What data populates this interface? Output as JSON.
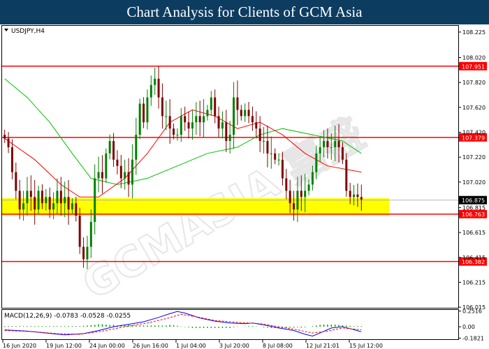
{
  "header": {
    "title": "Chart Analysis for Clients of GCM Asia"
  },
  "colors": {
    "bull": "#008000",
    "bear": "#800000",
    "level_line": "#ff0000",
    "zone": "#ffff00",
    "ma_fast": "#ff0000",
    "ma_slow": "#00c000",
    "macd_line": "#0000ff",
    "signal_line": "#ff0000",
    "histogram": "#00a000",
    "price_tag": "#ff0000",
    "current_tag": "#000000"
  },
  "chart_data": [
    {
      "type": "candlestick",
      "symbol_label": "USDJPY,H4",
      "ylim": [
        106.01,
        108.275
      ],
      "y_ticks": [
        "108.225",
        "108.020",
        "107.820",
        "107.620",
        "107.420",
        "107.220",
        "107.020",
        "106.815",
        "106.615",
        "106.415",
        "106.215",
        "106.015"
      ],
      "x_ticks": [
        "16 Jun 2020",
        "19 Jun 12:00",
        "24 Jun 00:00",
        "26 Jun 16:00",
        "1 Jul 04:00",
        "3 Jul 20:00",
        "8 Jul 08:00",
        "12 Jul 21:01",
        "15 Jul 12:00"
      ],
      "levels": [
        {
          "price": 107.951,
          "label": "107.951"
        },
        {
          "price": 107.379,
          "label": "107.379"
        },
        {
          "price": 106.763,
          "label": "106.763"
        },
        {
          "price": 106.382,
          "label": "106.382"
        }
      ],
      "zone": [
        106.75,
        106.89
      ],
      "current_price": {
        "price": 106.875,
        "label": "106.875"
      },
      "closes": [
        107.37,
        107.3,
        107.1,
        106.95,
        106.8,
        106.85,
        106.95,
        106.9,
        106.8,
        106.95,
        106.85,
        106.9,
        106.8,
        106.85,
        106.95,
        106.85,
        106.9,
        106.8,
        106.85,
        106.75,
        106.5,
        106.4,
        106.5,
        106.7,
        107.05,
        107.1,
        107.05,
        107.25,
        107.35,
        107.2,
        107.15,
        107.05,
        107.1,
        107.0,
        107.2,
        107.4,
        107.65,
        107.5,
        107.7,
        107.8,
        107.85,
        107.7,
        107.55,
        107.55,
        107.45,
        107.4,
        107.4,
        107.55,
        107.5,
        107.45,
        107.5,
        107.55,
        107.5,
        107.55,
        107.6,
        107.7,
        107.55,
        107.45,
        107.5,
        107.35,
        107.4,
        107.7,
        107.6,
        107.55,
        107.6,
        107.55,
        107.5,
        107.45,
        107.35,
        107.35,
        107.25,
        107.25,
        107.2,
        107.2,
        107.05,
        106.95,
        106.85,
        106.8,
        106.95,
        106.9,
        106.95,
        107.0,
        107.1,
        107.25,
        107.3,
        107.35,
        107.3,
        107.3,
        107.35,
        107.3,
        107.2,
        106.95,
        106.9,
        106.92,
        106.9,
        106.88
      ],
      "ma_fast": [
        {
          "i": 0,
          "v": 107.37
        },
        {
          "i": 8,
          "v": 107.2
        },
        {
          "i": 15,
          "v": 107.0
        },
        {
          "i": 20,
          "v": 106.9
        },
        {
          "i": 25,
          "v": 106.9
        },
        {
          "i": 32,
          "v": 107.05
        },
        {
          "i": 38,
          "v": 107.25
        },
        {
          "i": 44,
          "v": 107.5
        },
        {
          "i": 50,
          "v": 107.6
        },
        {
          "i": 56,
          "v": 107.55
        },
        {
          "i": 62,
          "v": 107.45
        },
        {
          "i": 68,
          "v": 107.5
        },
        {
          "i": 74,
          "v": 107.4
        },
        {
          "i": 80,
          "v": 107.25
        },
        {
          "i": 86,
          "v": 107.15
        },
        {
          "i": 95,
          "v": 107.1
        }
      ],
      "ma_slow": [
        {
          "i": 0,
          "v": 107.85
        },
        {
          "i": 6,
          "v": 107.7
        },
        {
          "i": 12,
          "v": 107.5
        },
        {
          "i": 18,
          "v": 107.25
        },
        {
          "i": 23,
          "v": 107.05
        },
        {
          "i": 30,
          "v": 107.0
        },
        {
          "i": 38,
          "v": 107.05
        },
        {
          "i": 46,
          "v": 107.15
        },
        {
          "i": 54,
          "v": 107.25
        },
        {
          "i": 62,
          "v": 107.3
        },
        {
          "i": 68,
          "v": 107.4
        },
        {
          "i": 74,
          "v": 107.45
        },
        {
          "i": 82,
          "v": 107.4
        },
        {
          "i": 90,
          "v": 107.35
        },
        {
          "i": 95,
          "v": 107.25
        }
      ]
    },
    {
      "type": "macd",
      "label": "MACD(12,26,9) -0.0783 -0.0528 -0.0255",
      "ylim": [
        -0.2,
        0.27
      ],
      "y_ticks": [
        "0.2516",
        "0.00",
        "-0.1821"
      ],
      "macd": [
        {
          "i": 0,
          "v": -0.05
        },
        {
          "i": 6,
          "v": -0.07
        },
        {
          "i": 11,
          "v": -0.1
        },
        {
          "i": 16,
          "v": -0.13
        },
        {
          "i": 21,
          "v": -0.11
        },
        {
          "i": 25,
          "v": -0.06
        },
        {
          "i": 29,
          "v": 0.0
        },
        {
          "i": 34,
          "v": 0.05
        },
        {
          "i": 37,
          "v": 0.08
        },
        {
          "i": 41,
          "v": 0.15
        },
        {
          "i": 44,
          "v": 0.21
        },
        {
          "i": 46,
          "v": 0.245
        },
        {
          "i": 48,
          "v": 0.22
        },
        {
          "i": 52,
          "v": 0.14
        },
        {
          "i": 56,
          "v": 0.09
        },
        {
          "i": 60,
          "v": 0.06
        },
        {
          "i": 64,
          "v": 0.05
        },
        {
          "i": 66,
          "v": 0.06
        },
        {
          "i": 69,
          "v": 0.03
        },
        {
          "i": 73,
          "v": -0.02
        },
        {
          "i": 77,
          "v": -0.06
        },
        {
          "i": 80,
          "v": -0.12
        },
        {
          "i": 82,
          "v": -0.15
        },
        {
          "i": 84,
          "v": -0.1
        },
        {
          "i": 87,
          "v": -0.02
        },
        {
          "i": 90,
          "v": 0.0
        },
        {
          "i": 92,
          "v": -0.03
        },
        {
          "i": 95,
          "v": -0.08
        }
      ],
      "signal": [
        {
          "i": 0,
          "v": -0.06
        },
        {
          "i": 8,
          "v": -0.08
        },
        {
          "i": 14,
          "v": -0.11
        },
        {
          "i": 20,
          "v": -0.12
        },
        {
          "i": 26,
          "v": -0.07
        },
        {
          "i": 32,
          "v": 0.0
        },
        {
          "i": 38,
          "v": 0.06
        },
        {
          "i": 43,
          "v": 0.13
        },
        {
          "i": 47,
          "v": 0.2
        },
        {
          "i": 51,
          "v": 0.16
        },
        {
          "i": 56,
          "v": 0.1
        },
        {
          "i": 62,
          "v": 0.07
        },
        {
          "i": 68,
          "v": 0.05
        },
        {
          "i": 73,
          "v": 0.0
        },
        {
          "i": 78,
          "v": -0.05
        },
        {
          "i": 82,
          "v": -0.1
        },
        {
          "i": 86,
          "v": -0.07
        },
        {
          "i": 90,
          "v": -0.02
        },
        {
          "i": 95,
          "v": -0.05
        }
      ],
      "histogram": [
        0.01,
        0.01,
        0.01,
        0.01,
        0.01,
        0.01,
        0.01,
        0.01,
        0.01,
        0.01,
        0.01,
        0.01,
        0.01,
        0.01,
        0.01,
        0.01,
        0.01,
        0.01,
        0.01,
        0.01,
        0.01,
        0.015,
        0.02,
        0.025,
        0.03,
        0.04,
        0.04,
        0.035,
        0.03,
        0.03,
        0.02,
        0.03,
        0.03,
        0.03,
        0.025,
        0.02,
        0.02,
        0.02,
        0.02,
        0.02,
        0.02,
        0.02,
        0.02,
        0.02,
        0.03,
        0.025,
        0.015,
        0.005,
        -0.005,
        -0.01,
        -0.02,
        -0.02,
        -0.02,
        -0.02,
        -0.02,
        -0.02,
        -0.02,
        -0.02,
        -0.02,
        -0.02,
        -0.02,
        -0.01,
        -0.005,
        0.0,
        0.005,
        0.01,
        0.01,
        0.005,
        0.0,
        -0.01,
        -0.015,
        -0.02,
        -0.02,
        -0.025,
        -0.02,
        -0.02,
        -0.015,
        -0.015,
        -0.01,
        -0.015,
        -0.01,
        0.0,
        0.01,
        0.02,
        0.03,
        0.035,
        0.035,
        0.035,
        0.035,
        0.03,
        0.025,
        0.02,
        0.015,
        0.01,
        0.01,
        0.01
      ]
    }
  ]
}
